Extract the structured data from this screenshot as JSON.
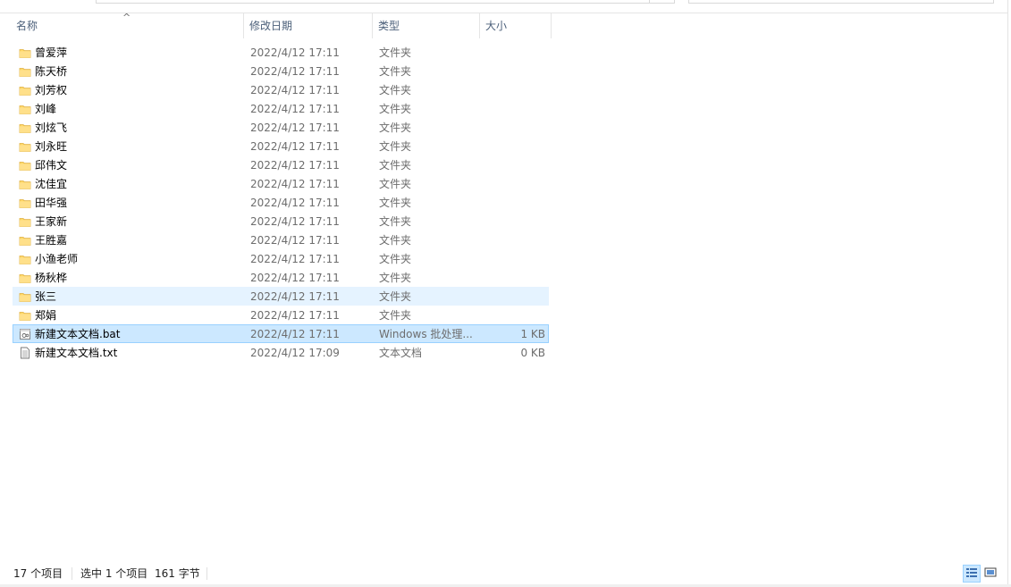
{
  "columns": {
    "name": "名称",
    "date": "修改日期",
    "type": "类型",
    "size": "大小"
  },
  "files": [
    {
      "name": "曾爱萍",
      "date": "2022/4/12 17:11",
      "type": "文件夹",
      "size": "",
      "icon": "folder-icon"
    },
    {
      "name": "陈天桥",
      "date": "2022/4/12 17:11",
      "type": "文件夹",
      "size": "",
      "icon": "folder-icon"
    },
    {
      "name": "刘芳权",
      "date": "2022/4/12 17:11",
      "type": "文件夹",
      "size": "",
      "icon": "folder-icon"
    },
    {
      "name": "刘峰",
      "date": "2022/4/12 17:11",
      "type": "文件夹",
      "size": "",
      "icon": "folder-icon"
    },
    {
      "name": "刘炫飞",
      "date": "2022/4/12 17:11",
      "type": "文件夹",
      "size": "",
      "icon": "folder-icon"
    },
    {
      "name": "刘永旺",
      "date": "2022/4/12 17:11",
      "type": "文件夹",
      "size": "",
      "icon": "folder-icon"
    },
    {
      "name": "邱伟文",
      "date": "2022/4/12 17:11",
      "type": "文件夹",
      "size": "",
      "icon": "folder-icon"
    },
    {
      "name": "沈佳宜",
      "date": "2022/4/12 17:11",
      "type": "文件夹",
      "size": "",
      "icon": "folder-icon"
    },
    {
      "name": "田华强",
      "date": "2022/4/12 17:11",
      "type": "文件夹",
      "size": "",
      "icon": "folder-icon"
    },
    {
      "name": "王家新",
      "date": "2022/4/12 17:11",
      "type": "文件夹",
      "size": "",
      "icon": "folder-icon"
    },
    {
      "name": "王胜嘉",
      "date": "2022/4/12 17:11",
      "type": "文件夹",
      "size": "",
      "icon": "folder-icon"
    },
    {
      "name": "小渔老师",
      "date": "2022/4/12 17:11",
      "type": "文件夹",
      "size": "",
      "icon": "folder-icon"
    },
    {
      "name": "杨秋桦",
      "date": "2022/4/12 17:11",
      "type": "文件夹",
      "size": "",
      "icon": "folder-icon"
    },
    {
      "name": "张三",
      "date": "2022/4/12 17:11",
      "type": "文件夹",
      "size": "",
      "icon": "folder-icon",
      "state": "hover"
    },
    {
      "name": "郑娟",
      "date": "2022/4/12 17:11",
      "type": "文件夹",
      "size": "",
      "icon": "folder-icon"
    },
    {
      "name": "新建文本文档.bat",
      "date": "2022/4/12 17:11",
      "type": "Windows 批处理...",
      "size": "1 KB",
      "icon": "batch-file-icon",
      "state": "selected"
    },
    {
      "name": "新建文本文档.txt",
      "date": "2022/4/12 17:09",
      "type": "文本文档",
      "size": "0 KB",
      "icon": "text-file-icon"
    }
  ],
  "status": {
    "item_count": "17 个项目",
    "selection": "选中 1 个项目",
    "selection_size": "161 字节"
  },
  "colors": {
    "selected_bg": "#cce8ff",
    "selected_border": "#99d1ff",
    "hover_bg": "#e5f3ff",
    "header_text": "#4c607a",
    "folder_yellow": "#ffd766"
  }
}
